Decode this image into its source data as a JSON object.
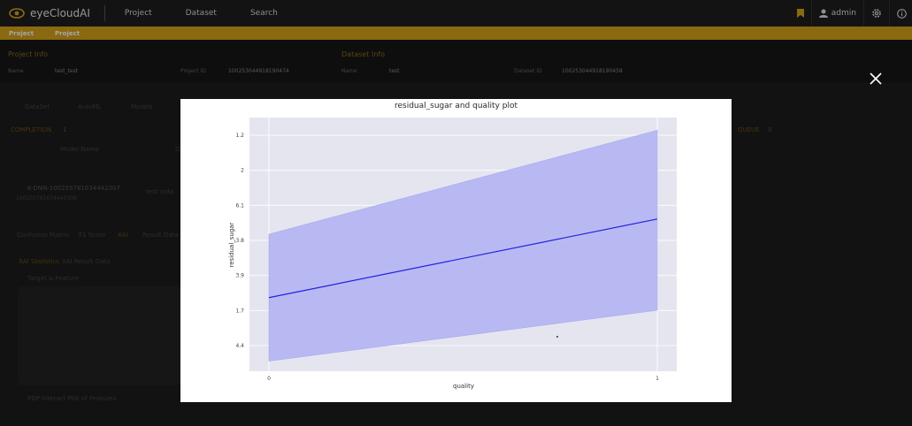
{
  "app": {
    "logo_text": "eyeCloudAI",
    "user": "admin"
  },
  "nav": {
    "items": [
      "Project",
      "Dataset",
      "Search"
    ]
  },
  "breadcrumb": [
    "Project",
    "Project"
  ],
  "project_info": {
    "title": "Project Info",
    "name_label": "Name",
    "name_value": "test_test",
    "id_label": "Project ID",
    "id_value": "100253044918190474"
  },
  "dataset_info": {
    "title": "Dataset Info",
    "name_label": "Name",
    "name_value": "test",
    "id_label": "Dataset ID",
    "id_value": "100253044918190458"
  },
  "bg": {
    "tabs": [
      "DataSet",
      "AutoML",
      "Models"
    ],
    "completion": "COMPLETION",
    "completion_count": "1",
    "queue": "QUEUE",
    "queue_count": "0",
    "col_model_name": "Model Name",
    "col_d": "D",
    "model_name": "K-DNN-100255781634442307",
    "model_id": "100255781634442309",
    "model_data": "test data",
    "metric_tabs": [
      "Confusion Matrix",
      "F1 Score",
      "XAI",
      "Result Data"
    ],
    "xai_tabs": [
      "XAI Statistics",
      "XAI Result Data"
    ],
    "target_feature": "Target & Feature",
    "pdp": "PDP Interact Plot of Features"
  },
  "colors": {
    "accent": "#d6a11a",
    "band": "#b2b4f3",
    "line": "#2222dd",
    "plot_bg": "#e5e5ef"
  },
  "icons": [
    "eye-logo-icon",
    "bookmark-icon",
    "user-icon",
    "gear-icon",
    "info-icon",
    "close-icon"
  ],
  "chart_data": {
    "type": "line",
    "title": "residual_sugar and quality plot",
    "xlabel": "quality",
    "ylabel": "residual_sugar",
    "x_ticks": [
      "0",
      "1"
    ],
    "y_ticks": [
      "1.2",
      "2",
      "6.1",
      "3.8",
      "3.9",
      "1.7",
      "4.4"
    ],
    "x": [
      0,
      1
    ],
    "series": [
      {
        "name": "",
        "type": "line",
        "y_frac": [
          0.29,
          0.6
        ]
      },
      {
        "name": "",
        "type": "band",
        "upper_frac": [
          0.54,
          0.95
        ],
        "lower_frac": [
          0.04,
          0.24
        ]
      }
    ],
    "grid": true
  }
}
